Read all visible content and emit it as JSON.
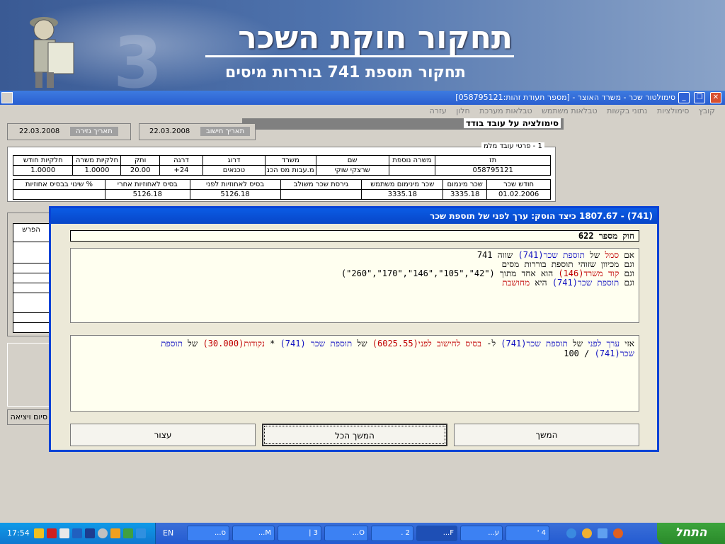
{
  "banner": {
    "title": "תחקור חוקת השכר",
    "subtitle": "תחקור תוספת 741 בוררות מיסים"
  },
  "window": {
    "title": "סימולטור שכר - משרד האוצר - [מספר תעודת זהות:058795121]"
  },
  "menu": [
    "קובץ",
    "סימולציות",
    "נתוני בקשות",
    "טבלאות משתמש",
    "טבלאות מערכת",
    "חלון",
    "עזרה"
  ],
  "simulation": {
    "title": "סימולציה על עובד בודד"
  },
  "dates": [
    {
      "label": "תאריך חישוב",
      "value": "22.03.2008"
    },
    {
      "label": "תאריך גזירה",
      "value": "22.03.2008"
    }
  ],
  "employee": {
    "group_title": "1 - פרטי עובד מלמ",
    "headers": [
      "תז",
      "משרה נוספת",
      "שם",
      "משרד",
      "דרוג",
      "דרגה",
      "ותק",
      "חלקיות משרה",
      "חלקיות חודש"
    ],
    "row": [
      "058795121",
      "",
      "שרצקי שוקי",
      "מ.עבות מס הכנ",
      "טכנאים",
      "24+",
      "20.00",
      "1.0000",
      "1.0000"
    ]
  },
  "salary": {
    "headers": [
      "חודש שכר",
      "שכר מינמום",
      "שכר מינימום משתמש",
      "גירסת שכר משולב",
      "בסיס לאחוזיות לפני",
      "בסיס לאחוזיות אחרי",
      "% שינוי בבסיס אחוזיות"
    ],
    "row": [
      "01.02.2006",
      "3335.18",
      "3335.18",
      "",
      "5126.18",
      "5126.18",
      ""
    ]
  },
  "side_table": {
    "header": "הפרש"
  },
  "exit_button": "סיום ויציאה",
  "dialog": {
    "title": "(741) - 1807.67 כיצד הוסק: ערך לפני של תוספת שכר",
    "rule_name": "חוק מספר 622",
    "conditions": [
      [
        {
          "t": "אם "
        },
        {
          "t": "סמל",
          "c": "red"
        },
        {
          "t": " של "
        },
        {
          "t": "תוספת שכר(741)",
          "c": "blue"
        },
        {
          "t": " שווה 741"
        }
      ],
      [
        {
          "t": "וגם מכיוון שזוהי תוספת בוררות מסים"
        }
      ],
      [
        {
          "t": "וגם "
        },
        {
          "t": "קוד משרד(146)",
          "c": "red"
        },
        {
          "t": " הוא אחד מתוך (\"42\",\"105\",\"146\",\"170\",\"260\")"
        }
      ],
      [
        {
          "t": "וגם "
        },
        {
          "t": "תוספת שכר(741)",
          "c": "blue"
        },
        {
          "t": " היא "
        },
        {
          "t": "מחושבת",
          "c": "red"
        }
      ]
    ],
    "calculation": [
      [
        {
          "t": "אזי "
        },
        {
          "t": "ערך לפני",
          "c": "blue"
        },
        {
          "t": " של "
        },
        {
          "t": "תוספת שכר(741)",
          "c": "blue"
        },
        {
          "t": " ל- "
        },
        {
          "t": "בסיס לחישוב לפני(6025.55)",
          "c": "red"
        },
        {
          "t": " של "
        },
        {
          "t": "תוספת שכר (741)",
          "c": "blue"
        },
        {
          "t": " * "
        },
        {
          "t": "נקודות(30.000)",
          "c": "red"
        },
        {
          "t": " של "
        },
        {
          "t": "תוספת",
          "c": "blue"
        }
      ],
      [
        {
          "t": "שכר(741)",
          "c": "blue"
        },
        {
          "t": " / 100"
        }
      ]
    ],
    "buttons": {
      "continue": "המשך",
      "continue_all": "המשך הכל",
      "stop": "עצור"
    }
  },
  "taskbar": {
    "start": "התחל",
    "clock": "17:54",
    "lang": "EN",
    "tasks": [
      "ס...",
      "M...",
      "3 |",
      "O...",
      "2 .",
      "F...",
      "ע...",
      "4 '"
    ]
  }
}
